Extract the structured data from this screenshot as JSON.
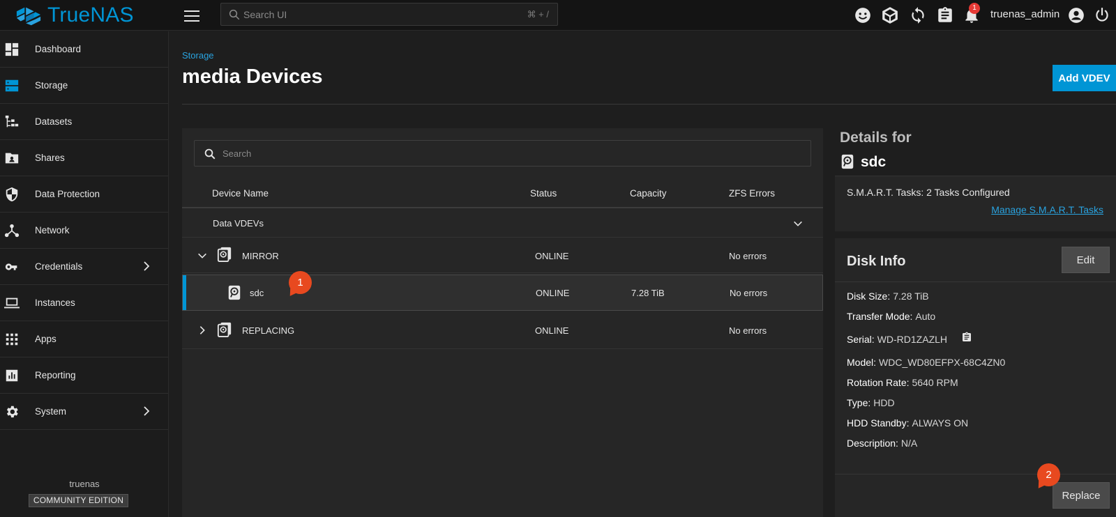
{
  "app": {
    "name": "TrueNAS"
  },
  "topbar": {
    "search_placeholder": "Search UI",
    "search_shortcut": "⌘ + /",
    "notification_count": "1",
    "username": "truenas_admin",
    "icons": [
      "feedback-icon",
      "truecommand-icon",
      "jobs-icon",
      "tasks-icon",
      "notifications-icon",
      "account-icon",
      "power-icon"
    ]
  },
  "sidebar": {
    "items": [
      {
        "label": "Dashboard",
        "icon": "dashboard-icon"
      },
      {
        "label": "Storage",
        "icon": "storage-icon",
        "active": true
      },
      {
        "label": "Datasets",
        "icon": "datasets-icon"
      },
      {
        "label": "Shares",
        "icon": "shares-icon"
      },
      {
        "label": "Data Protection",
        "icon": "shield-icon"
      },
      {
        "label": "Network",
        "icon": "network-icon"
      },
      {
        "label": "Credentials",
        "icon": "key-icon",
        "has_children": true
      },
      {
        "label": "Instances",
        "icon": "laptop-icon"
      },
      {
        "label": "Apps",
        "icon": "apps-grid-icon"
      },
      {
        "label": "Reporting",
        "icon": "reporting-icon"
      },
      {
        "label": "System",
        "icon": "gear-icon",
        "has_children": true
      }
    ],
    "hostname": "truenas",
    "edition": "COMMUNITY EDITION"
  },
  "main": {
    "breadcrumb": "Storage",
    "title": "media Devices",
    "add_vdev_label": "Add VDEV"
  },
  "devices": {
    "search_placeholder": "Search",
    "columns": [
      "Device Name",
      "Status",
      "Capacity",
      "ZFS Errors"
    ],
    "group_label": "Data VDEVs",
    "rows": [
      {
        "name": "MIRROR",
        "status": "ONLINE",
        "capacity": "",
        "errors": "No errors",
        "expanded": true
      },
      {
        "name": "sdc",
        "status": "ONLINE",
        "capacity": "7.28 TiB",
        "errors": "No errors",
        "selected": true
      },
      {
        "name": "REPLACING",
        "status": "ONLINE",
        "capacity": "",
        "errors": "No errors",
        "expanded": false
      }
    ]
  },
  "details": {
    "title": "Details for",
    "disk_name": "sdc",
    "smart_label": "S.M.A.R.T. Tasks:",
    "smart_value": "2 Tasks Configured",
    "smart_link": "Manage S.M.A.R.T. Tasks",
    "disk_info_title": "Disk Info",
    "edit_label": "Edit",
    "fields": [
      {
        "label": "Disk Size:",
        "value": "7.28 TiB"
      },
      {
        "label": "Transfer Mode:",
        "value": "Auto"
      },
      {
        "label": "Serial:",
        "value": "WD-RD1ZAZLH"
      },
      {
        "label": "Model:",
        "value": "WDC_WD80EFPX-68C4ZN0"
      },
      {
        "label": "Rotation Rate:",
        "value": "5640 RPM"
      },
      {
        "label": "Type:",
        "value": "HDD"
      },
      {
        "label": "HDD Standby:",
        "value": "ALWAYS ON"
      },
      {
        "label": "Description:",
        "value": "N/A"
      }
    ],
    "replace_label": "Replace"
  },
  "markers": [
    "1",
    "2"
  ],
  "colors": {
    "accent": "#0095d5",
    "marker": "#e8491f",
    "background": "#1e1e1e"
  }
}
